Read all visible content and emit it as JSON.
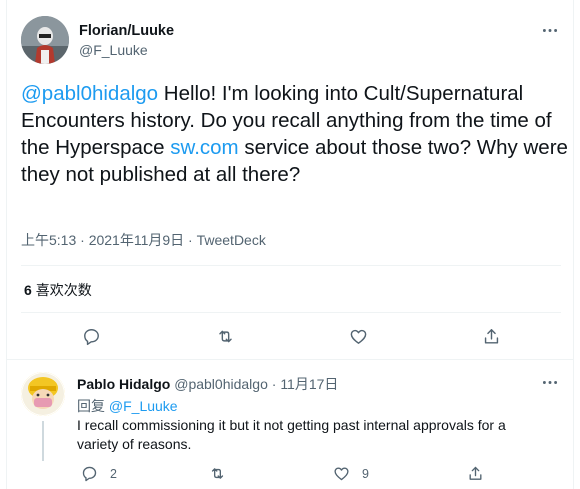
{
  "tweet": {
    "author_name": "Florian/Luuke",
    "author_handle": "@F_Luuke",
    "mention": "@pabl0hidalgo",
    "text_part1": " Hello! I'm looking into Cult/Supernatural Encounters history. Do you recall anything from the time of the Hyperspace ",
    "link_text": "sw.com",
    "text_part2": " service about those two? Why were they not published at all there?",
    "timestamp": "上午5:13 · 2021年11月9日 · TweetDeck",
    "likes_count": "6",
    "likes_label": "喜欢次数"
  },
  "reply": {
    "author_name": "Pablo Hidalgo",
    "author_handle": "@pabl0hidalgo",
    "separator": " · ",
    "date": "11月17日",
    "replying_label": "回复 ",
    "replying_to": "@F_Luuke",
    "text": "I recall commissioning it but it not getting past internal approvals for a variety of reasons.",
    "reply_count": "2",
    "like_count": "9"
  },
  "icons": {
    "more": "more-icon",
    "reply": "reply-icon",
    "retweet": "retweet-icon",
    "like": "heart-icon",
    "share": "share-icon"
  },
  "colors": {
    "link": "#1d9bf0",
    "secondary_text": "#536471",
    "primary_text": "#0f1419"
  }
}
